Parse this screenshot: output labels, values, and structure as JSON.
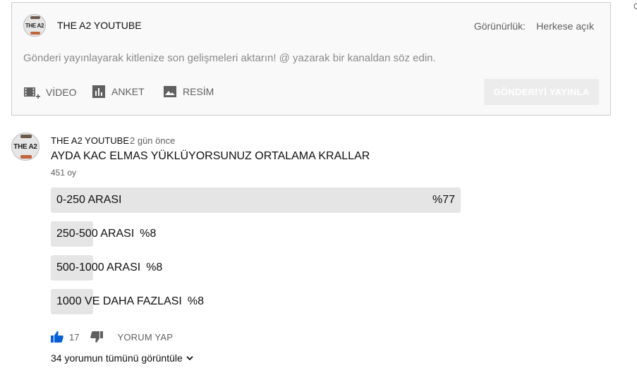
{
  "composer": {
    "channel_name": "THE A2 YOUTUBE",
    "avatar_text": "THE A2",
    "visibility_label": "Görünürlük:",
    "visibility_value": "Herkese açık",
    "placeholder": "Gönderi yayınlayarak kitlenize son gelişmeleri aktarın! @ yazarak bir kanaldan söz edin.",
    "attachments": [
      {
        "label": "VİDEO",
        "icon": "video-add-icon"
      },
      {
        "label": "ANKET",
        "icon": "poll-icon"
      },
      {
        "label": "RESİM",
        "icon": "image-icon"
      }
    ],
    "publish_label": "GÖNDERİYİ YAYINLA"
  },
  "post": {
    "author": "THE A2 YOUTUBE",
    "avatar_text": "THE A2",
    "time": "2 gün önce",
    "text": "AYDA KAC ELMAS YÜKLÜYORSUNUZ ORTALAMA KRALLAR",
    "votes": "451 oy",
    "options": [
      {
        "label": "0-250 ARASI",
        "percent": "%77",
        "share": 77
      },
      {
        "label": "250-500 ARASI",
        "percent": "%8",
        "share": 8
      },
      {
        "label": "500-1000 ARASI",
        "percent": "%8",
        "share": 8
      },
      {
        "label": "1000 VE DAHA FAZLASI",
        "percent": "%8",
        "share": 8
      }
    ],
    "likes": "17",
    "reply_label": "YORUM YAP",
    "view_comments": "34 yorumun tümünü görüntüle"
  },
  "edge_text": "G",
  "colors": {
    "bar_fill": "#e5e5e5",
    "like_blue": "#065fd4",
    "muted": "#606060"
  }
}
